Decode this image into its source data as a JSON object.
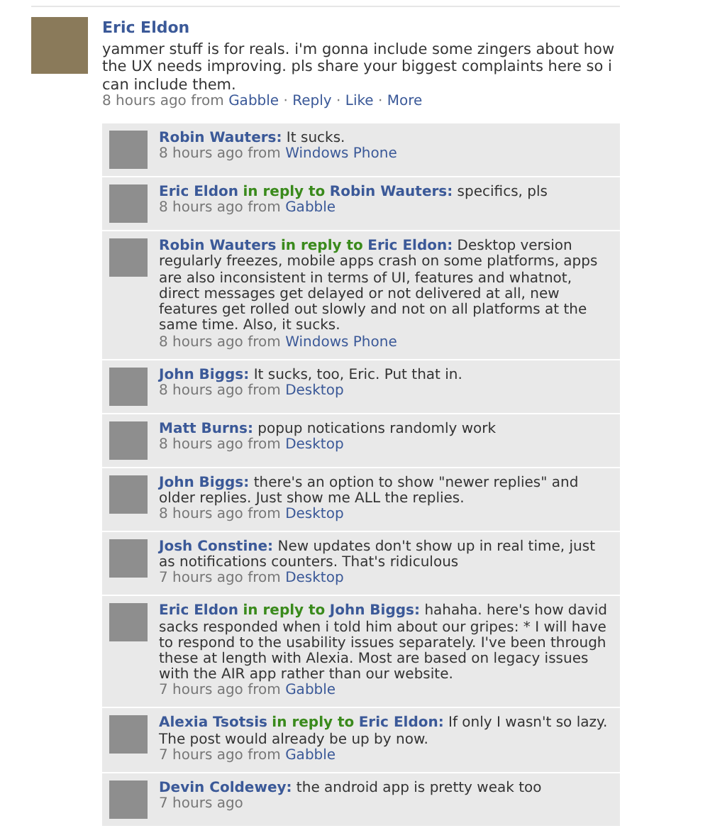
{
  "post": {
    "author": "Eric Eldon",
    "text": "yammer stuff is for reals. i'm gonna include some zingers about how the UX needs improving. pls share your biggest complaints here so i can include them.",
    "time": "8 hours ago",
    "from_label": "from",
    "source": "Gabble",
    "separator": "·",
    "actions": [
      "Reply",
      "Like",
      "More"
    ]
  },
  "replies": [
    {
      "author": "Robin Wauters:",
      "text": "It sucks.",
      "time": "8 hours ago",
      "from_label": "from",
      "source": "Windows Phone"
    },
    {
      "author": "Eric Eldon",
      "reply_label": "in reply to",
      "reply_to": "Robin Wauters:",
      "text": "specifics, pls",
      "time": "8 hours ago",
      "from_label": "from",
      "source": "Gabble"
    },
    {
      "author": "Robin Wauters",
      "reply_label": "in reply to",
      "reply_to": "Eric Eldon:",
      "text": "Desktop version regularly freezes, mobile apps crash on some platforms, apps are also inconsistent in terms of UI, features and whatnot, direct messages get delayed or not delivered at all, new features get rolled out slowly and not on all platforms at the same time. Also, it sucks.",
      "time": "8 hours ago",
      "from_label": "from",
      "source": "Windows Phone"
    },
    {
      "author": "John Biggs:",
      "text": "It sucks, too, Eric. Put that in.",
      "time": "8 hours ago",
      "from_label": "from",
      "source": "Desktop"
    },
    {
      "author": "Matt Burns:",
      "text": "popup notications randomly work",
      "time": "8 hours ago",
      "from_label": "from",
      "source": "Desktop"
    },
    {
      "author": "John Biggs:",
      "text": "there's an option to show \"newer replies\" and older replies. Just show me ALL the replies.",
      "time": "8 hours ago",
      "from_label": "from",
      "source": "Desktop"
    },
    {
      "author": "Josh Constine:",
      "text": "New updates don't show up in real time, just as notifications counters. That's ridiculous",
      "time": "7 hours ago",
      "from_label": "from",
      "source": "Desktop"
    },
    {
      "author": "Eric Eldon",
      "reply_label": "in reply to",
      "reply_to": "John Biggs:",
      "text": "hahaha. here's how david sacks responded when i told him about our gripes: * I will have to respond to the usability issues separately. I've been through these at length with Alexia. Most are based on legacy issues with the AIR app rather than our website.",
      "time": "7 hours ago",
      "from_label": "from",
      "source": "Gabble"
    },
    {
      "author": "Alexia Tsotsis",
      "reply_label": "in reply to",
      "reply_to": "Eric Eldon:",
      "text": "If only I wasn't so lazy. The post would already be up by now.",
      "time": "7 hours ago",
      "from_label": "from",
      "source": "Gabble"
    },
    {
      "author": "Devin Coldewey:",
      "text": "the android app is pretty weak too",
      "time": "7 hours ago"
    }
  ]
}
